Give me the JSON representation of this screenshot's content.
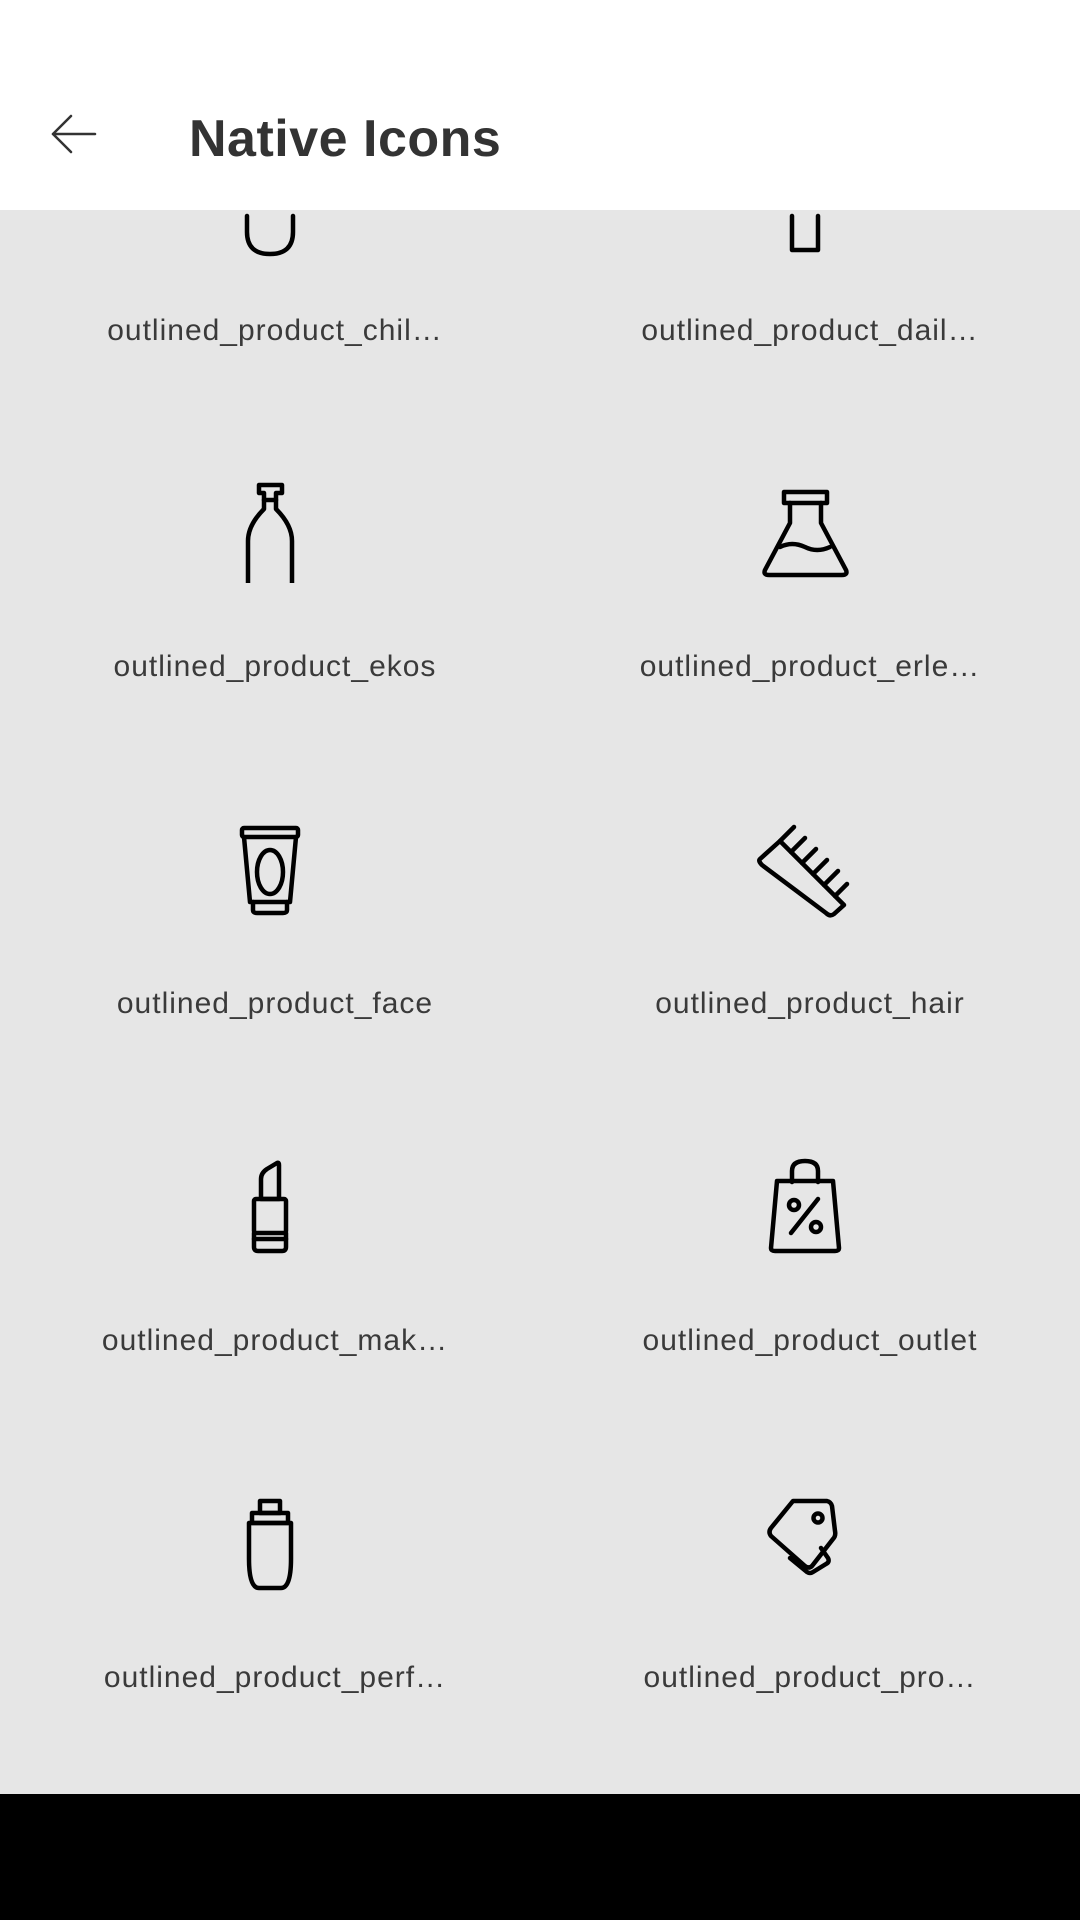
{
  "header": {
    "title": "Native Icons",
    "back_icon": "arrow-left-icon"
  },
  "icons": [
    {
      "label": "outlined_product_chil…",
      "icon": "children-product-icon"
    },
    {
      "label": "outlined_product_dail…",
      "icon": "daily-product-icon"
    },
    {
      "label": "outlined_product_ekos",
      "icon": "pump-bottle-icon"
    },
    {
      "label": "outlined_product_erle…",
      "icon": "erlenmeyer-flask-icon"
    },
    {
      "label": "outlined_product_face",
      "icon": "face-cream-tube-icon"
    },
    {
      "label": "outlined_product_hair",
      "icon": "comb-icon"
    },
    {
      "label": "outlined_product_mak…",
      "icon": "lipstick-icon"
    },
    {
      "label": "outlined_product_outlet",
      "icon": "discount-bag-icon"
    },
    {
      "label": "outlined_product_perf…",
      "icon": "perfume-bottle-icon"
    },
    {
      "label": "outlined_product_pro…",
      "icon": "price-tag-icon"
    }
  ],
  "colors": {
    "header_bg": "#ffffff",
    "content_bg": "#e6e6e6",
    "title": "#333333",
    "label": "#3a3a3a",
    "icon_stroke": "#000000",
    "nav_bar": "#000000"
  }
}
